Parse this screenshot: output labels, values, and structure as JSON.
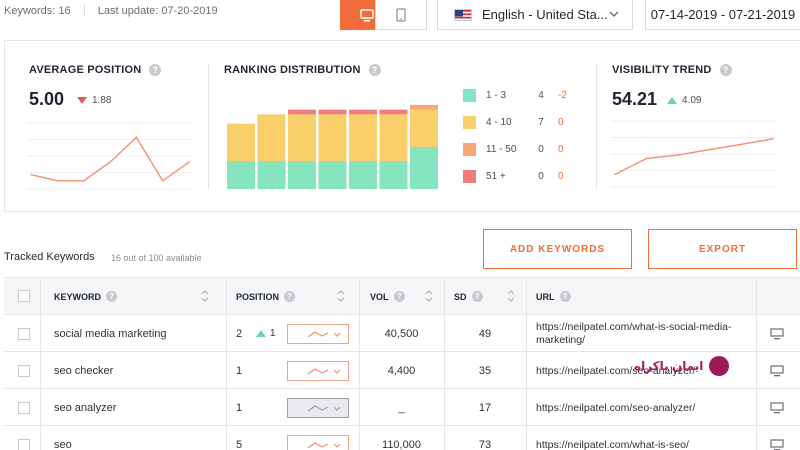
{
  "topbar": {
    "keywords": "Keywords: 16",
    "last_update": "Last update: 07-20-2019",
    "language": "English - United Sta...",
    "date_range": "07-14-2019 - 07-21-2019",
    "device_selected": "desktop"
  },
  "stats": {
    "average_position": {
      "title": "AVERAGE POSITION",
      "value": "5.00",
      "delta": "1.88"
    },
    "ranking_distribution": {
      "title": "RANKING DISTRIBUTION",
      "legend": [
        {
          "label": "1 - 3",
          "count": "4",
          "change": "-2",
          "color": "#86e5bf"
        },
        {
          "label": "4 - 10",
          "count": "7",
          "change": "0",
          "color": "#f9cf6b"
        },
        {
          "label": "11 - 50",
          "count": "0",
          "change": "0",
          "color": "#f7a779"
        },
        {
          "label": "51 +",
          "count": "0",
          "change": "0",
          "color": "#f27b7b"
        }
      ]
    },
    "visibility_trend": {
      "title": "VISIBILITY TREND",
      "value": "54.21",
      "delta": "4.09"
    }
  },
  "chart_data": [
    {
      "type": "line",
      "x": [
        1,
        2,
        3,
        4,
        5,
        6,
        7
      ],
      "values": [
        8,
        9,
        9,
        6,
        2,
        9,
        6
      ],
      "ylim": [
        0,
        10
      ],
      "inverted": true,
      "color": "#f2906e"
    },
    {
      "type": "bar",
      "stacked": true,
      "categories": [
        "1",
        "2",
        "3",
        "4",
        "5",
        "6",
        "7"
      ],
      "series": [
        {
          "values": [
            6,
            6,
            6,
            6,
            6,
            6,
            9
          ],
          "color": "#86e5bf"
        },
        {
          "values": [
            8,
            10,
            10,
            10,
            10,
            10,
            8
          ],
          "color": "#f9cf6b"
        },
        {
          "values": [
            0,
            0,
            0,
            0,
            0,
            0,
            1
          ],
          "color": "#f7a779"
        },
        {
          "values": [
            0,
            0,
            1,
            1,
            1,
            1,
            0
          ],
          "color": "#f27b7b"
        }
      ],
      "ylim": [
        0,
        18
      ]
    },
    {
      "type": "line",
      "x": [
        1,
        2,
        3,
        4,
        5,
        6
      ],
      "values": [
        50.2,
        52.0,
        52.4,
        53.0,
        53.6,
        54.21
      ],
      "ylim": [
        49,
        56
      ],
      "color": "#f2906e"
    }
  ],
  "actions": {
    "tracked_label": "Tracked Keywords",
    "tracked_count": "16 out of 100 available",
    "add_keywords": "ADD KEYWORDS",
    "export": "EXPORT"
  },
  "table": {
    "headers": {
      "keyword": "KEYWORD",
      "position": "POSITION",
      "vol": "VOL",
      "sd": "SD",
      "url": "URL"
    },
    "rows": [
      {
        "keyword": "social media marketing",
        "position": "2",
        "position_delta": "1",
        "trend": "up",
        "vol": "40,500",
        "sd": "49",
        "url": "https://neilpatel.com/what-is-social-media-marketing/"
      },
      {
        "keyword": "seo checker",
        "position": "1",
        "position_delta": "",
        "trend": "normal",
        "vol": "4,400",
        "sd": "35",
        "url": "https://neilpatel.com/seo-analyzer/"
      },
      {
        "keyword": "seo analyzer",
        "position": "1",
        "position_delta": "",
        "trend": "grey",
        "vol": "_",
        "sd": "17",
        "url": "https://neilpatel.com/seo-analyzer/"
      },
      {
        "keyword": "seo",
        "position": "5",
        "position_delta": "",
        "trend": "normal",
        "vol": "110,000",
        "sd": "73",
        "url": "https://neilpatel.com/what-is-seo/"
      }
    ]
  },
  "watermark": {
    "text": "ایمان پاکراه"
  }
}
